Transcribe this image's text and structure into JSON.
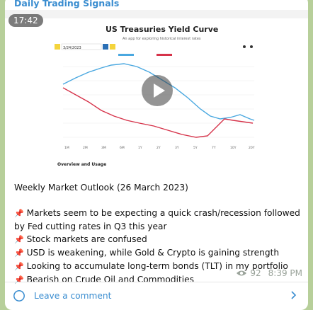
{
  "channel": {
    "name": "Daily Trading Signals"
  },
  "video": {
    "duration": "17:42",
    "preview": {
      "title": "US Treasuries Yield Curve",
      "subtitle": "An app for exploring historical interest rates",
      "date_value": "3/24/2023",
      "section_label": "Overview and Usage"
    }
  },
  "caption": {
    "heading": "Weekly Market Outlook (26 March 2023)",
    "bullet_icon": "pushpin-icon",
    "bullets": [
      "Markets seem to be expecting a quick crash/recession followed by Fed cutting rates in Q3 this year",
      "Stock markets are confused",
      "USD is weakening, while Gold & Crypto is gaining strength",
      "Looking to accumulate long-term bonds (TLT) in my portfolio",
      "Bearish on Crude Oil and Commodities"
    ]
  },
  "meta": {
    "views": "92",
    "time": "8:39 PM"
  },
  "comment": {
    "label": "Leave a comment"
  },
  "colors": {
    "accent": "#3a8dd0",
    "bubble": "#ffffff",
    "background": "#b7cf9a",
    "series_blue": "#4aa8e0",
    "series_red": "#d6334a"
  }
}
